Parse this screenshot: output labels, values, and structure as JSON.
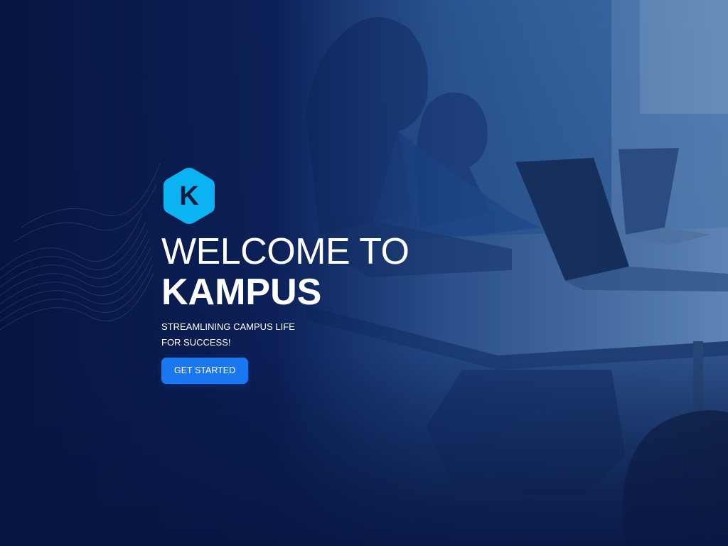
{
  "brand": {
    "logo_letter": "K",
    "logo_color": "#0bb3f2"
  },
  "hero": {
    "title_line1": "WELCOME TO",
    "title_line2": "KAMPUS",
    "subtitle_line1": "STREAMLINING CAMPUS LIFE",
    "subtitle_line2": "FOR SUCCESS!",
    "cta_label": "GET STARTED"
  },
  "colors": {
    "background": "#061540",
    "accent": "#1978f0",
    "text": "#ffffff"
  }
}
